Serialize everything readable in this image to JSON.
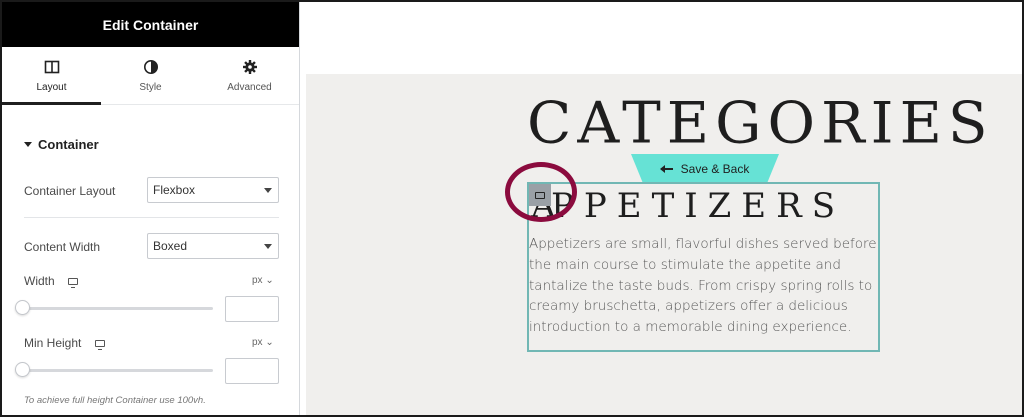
{
  "panel": {
    "title": "Edit Container",
    "tabs": [
      {
        "label": "Layout",
        "icon": "layout-icon",
        "active": true
      },
      {
        "label": "Style",
        "icon": "half-circle-icon",
        "active": false
      },
      {
        "label": "Advanced",
        "icon": "gear-icon",
        "active": false
      }
    ],
    "section_title": "Container",
    "container_layout": {
      "label": "Container Layout",
      "value": "Flexbox"
    },
    "content_width": {
      "label": "Content Width",
      "value": "Boxed"
    },
    "width": {
      "label": "Width",
      "unit": "px ⌄",
      "value": ""
    },
    "min_height": {
      "label": "Min Height",
      "unit": "px ⌄",
      "value": ""
    },
    "hint": "To achieve full height Container use 100vh."
  },
  "canvas": {
    "heading": "CATEGORIES",
    "save_back": "Save & Back",
    "subheading_first": "A",
    "subheading_rest": "PPETIZERS",
    "paragraph": "Appetizers are small, flavorful dishes served before the main course to stimulate the appetite and tantalize the taste buds. From crispy spring rolls to creamy bruschetta, appetizers offer a delicious introduction to a memorable dining experience."
  },
  "colors": {
    "header_bg": "#000000",
    "save_back_bg": "#66e2d5",
    "container_outline": "#71b7b4",
    "highlight_circle": "#8b0b3e",
    "canvas_bg": "#f0efed"
  }
}
